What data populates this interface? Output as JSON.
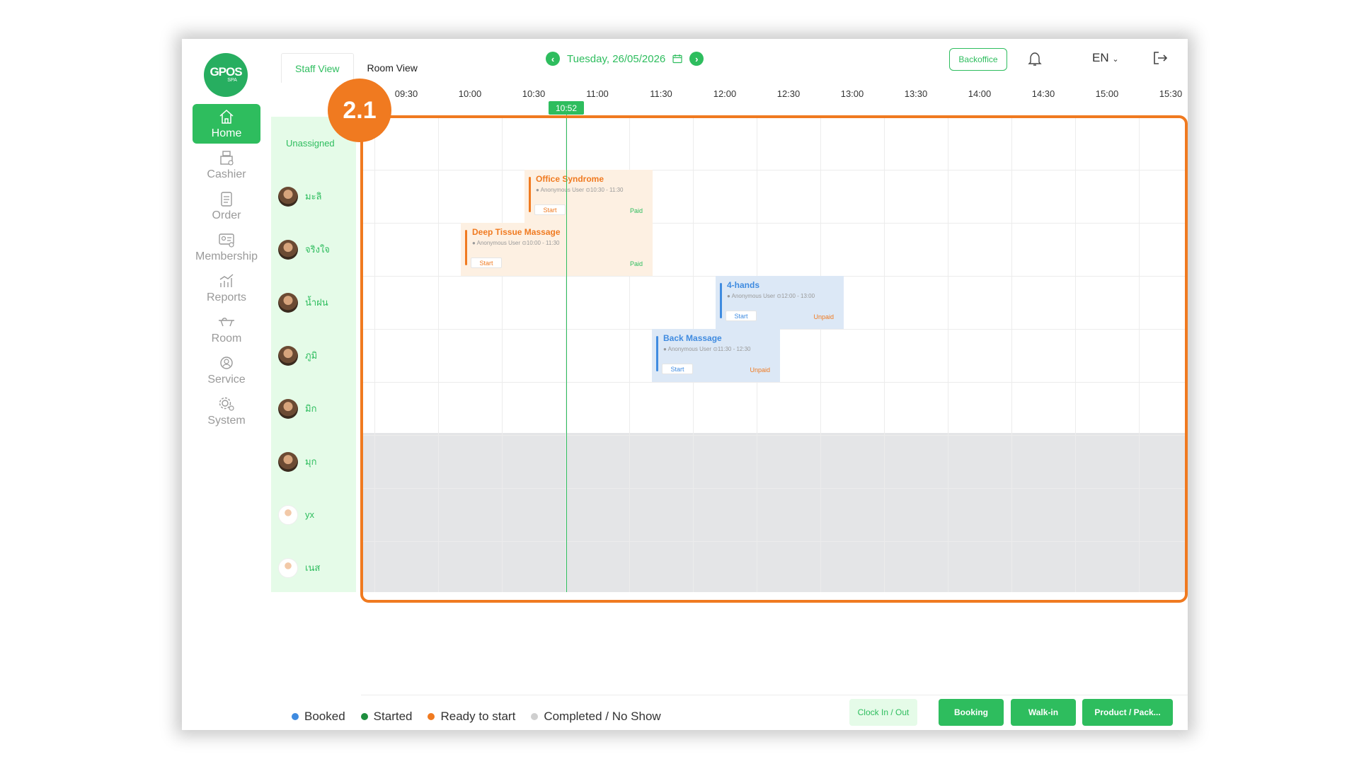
{
  "app": {
    "logo_text": "GPOS",
    "logo_sub": "SPA"
  },
  "sidebar": {
    "items": [
      {
        "label": "Home",
        "icon": "home-icon"
      },
      {
        "label": "Cashier",
        "icon": "cash-register-icon"
      },
      {
        "label": "Order",
        "icon": "clipboard-icon"
      },
      {
        "label": "Membership",
        "icon": "membership-card-icon"
      },
      {
        "label": "Reports",
        "icon": "bar-chart-icon"
      },
      {
        "label": "Room",
        "icon": "massage-bed-icon"
      },
      {
        "label": "Service",
        "icon": "service-icon"
      },
      {
        "label": "System",
        "icon": "gear-icon"
      }
    ]
  },
  "header": {
    "tabs": [
      {
        "label": "Staff View"
      },
      {
        "label": "Room View"
      }
    ],
    "date": "Tuesday, 26/05/2026",
    "backoffice": "Backoffice",
    "language": "EN"
  },
  "timeline": {
    "times": [
      "09:30",
      "10:00",
      "10:30",
      "11:00",
      "11:30",
      "12:00",
      "12:30",
      "13:00",
      "13:30",
      "14:00",
      "14:30",
      "15:00",
      "15:30"
    ],
    "now": "10:52"
  },
  "staff": [
    {
      "name": "Unassigned"
    },
    {
      "name": "มะลิ"
    },
    {
      "name": "จริงใจ"
    },
    {
      "name": "น้ำฝน"
    },
    {
      "name": "ภูมิ"
    },
    {
      "name": "มิก"
    },
    {
      "name": "มุก"
    },
    {
      "name": "yx"
    },
    {
      "name": "เนส"
    }
  ],
  "appointments": [
    {
      "service": "Office Syndrome",
      "customer": "Anonymous User",
      "time": "10:30 - 11:30",
      "action": "Start",
      "payment": "Paid"
    },
    {
      "service": "Deep Tissue Massage",
      "customer": "Anonymous User",
      "time": "10:00 - 11:30",
      "action": "Start",
      "payment": "Paid"
    },
    {
      "service": "4-hands",
      "customer": "Anonymous User",
      "time": "12:00 - 13:00",
      "action": "Start",
      "payment": "Unpaid"
    },
    {
      "service": "Back Massage",
      "customer": "Anonymous User",
      "time": "11:30 - 12:30",
      "action": "Start",
      "payment": "Unpaid"
    }
  ],
  "annotation": {
    "badge": "2.1"
  },
  "legend": [
    {
      "label": "Booked",
      "color": "#3f8be0"
    },
    {
      "label": "Started",
      "color": "#1e8e3e"
    },
    {
      "label": "Ready to start",
      "color": "#f07a20"
    },
    {
      "label": "Completed / No Show",
      "color": "#cfcfcf"
    }
  ],
  "footer_buttons": [
    {
      "label": "Clock In / Out"
    },
    {
      "label": "Booking"
    },
    {
      "label": "Walk-in"
    },
    {
      "label": "Product / Pack..."
    }
  ],
  "colors": {
    "accent": "#2ebd5e",
    "highlight": "#f07a20"
  }
}
